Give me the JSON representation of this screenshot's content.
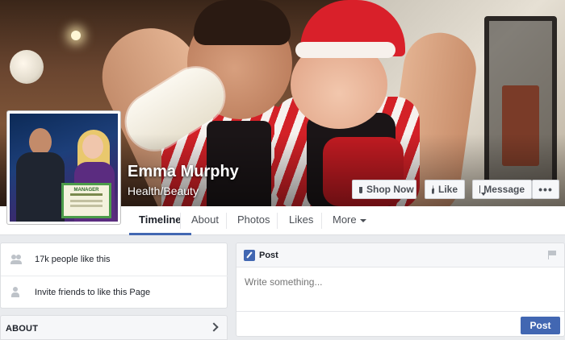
{
  "page": {
    "name": "Emma Murphy",
    "category": "Health/Beauty",
    "profile_photo_text": "MANAGER"
  },
  "cover_actions": {
    "shop_now": "Shop Now",
    "like": "Like",
    "message": "Message",
    "more": "•••"
  },
  "tabs": [
    {
      "label": "Timeline",
      "active": true
    },
    {
      "label": "About",
      "active": false
    },
    {
      "label": "Photos",
      "active": false
    },
    {
      "label": "Likes",
      "active": false
    },
    {
      "label": "More",
      "active": false
    }
  ],
  "sidebar": {
    "likes_text": "17k people like this",
    "invite_text": "Invite friends to like this Page",
    "about_heading": "ABOUT"
  },
  "composer": {
    "title": "Post",
    "placeholder": "Write something...",
    "submit_label": "Post"
  },
  "colors": {
    "accent": "#4267b2",
    "background": "#e9ebee"
  },
  "icons": [
    "cart-icon",
    "like-icon",
    "message-icon",
    "people-icon",
    "invite-icon",
    "pencil-icon",
    "flag-icon",
    "chevron-right-icon",
    "caret-down-icon"
  ]
}
